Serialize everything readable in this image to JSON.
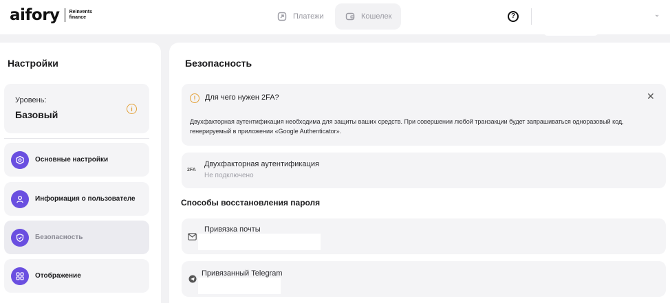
{
  "header": {
    "logo": "aifory",
    "logo_sub": "Reinvents finance",
    "nav": [
      {
        "label": "Платежи",
        "icon": "payments-icon",
        "active": false
      },
      {
        "label": "Кошелек",
        "icon": "wallet-icon",
        "active": true
      }
    ],
    "help_icon": "?"
  },
  "sidebar": {
    "title": "Настройки",
    "level": {
      "label": "Уровень:",
      "value": "Базовый",
      "icon": "i"
    },
    "items": [
      {
        "label": "Основные настройки",
        "icon": "hexagon-settings-icon"
      },
      {
        "label": "Информация о пользователе",
        "icon": "user-icon"
      },
      {
        "label": "Безопасность",
        "icon": "shield-icon"
      },
      {
        "label": "Отображение",
        "icon": "grid-display-icon"
      }
    ]
  },
  "main": {
    "title": "Безопасность",
    "alert": {
      "icon": "!",
      "title": "Для чего нужен 2FA?",
      "close": "✕",
      "text": "Двухфакторная аутентификация необходима для защиты ваших средств. При совершении любой транзакции будет запрашиваться одноразовый код, генерируемый в приложении «Google Authenticator»."
    },
    "twofa": {
      "badge": "2FA",
      "title": "Двухфакторная аутентификация",
      "status": "Не подключено"
    },
    "recovery": {
      "title": "Способы восстановления пароля",
      "items": [
        {
          "label": "Привязка почты",
          "icon": "mail-icon"
        },
        {
          "label": "Привязанный Telegram",
          "icon": "telegram-icon"
        }
      ]
    }
  },
  "colors": {
    "accent": "#6a4fe0",
    "warning": "#e3a23b",
    "panel": "#ffffff",
    "card": "#f4f4f6",
    "background": "#f2f2f4"
  }
}
